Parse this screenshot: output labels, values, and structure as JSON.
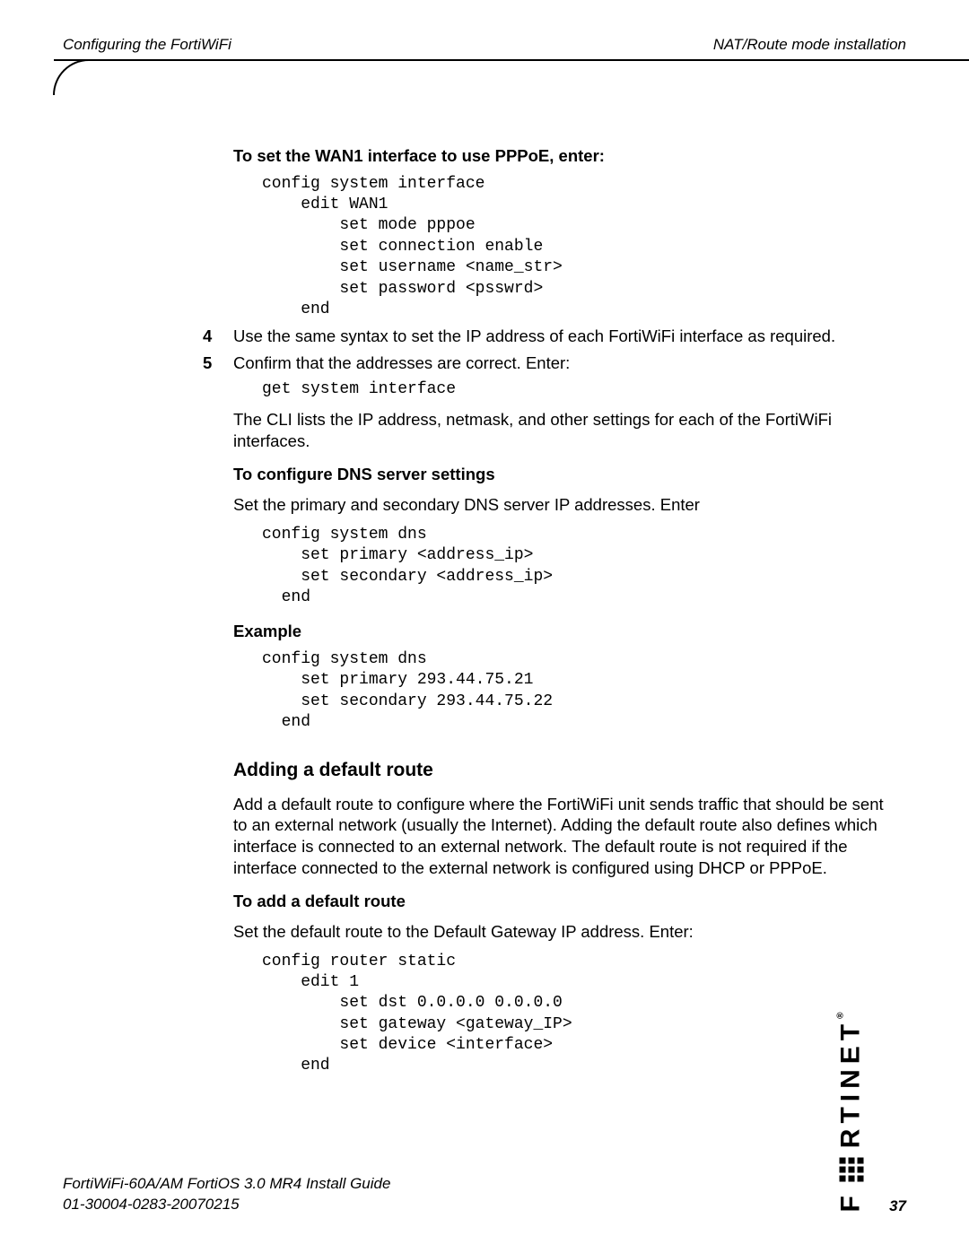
{
  "header": {
    "left": "Configuring the FortiWiFi",
    "right": "NAT/Route mode installation"
  },
  "sections": {
    "pppoe_heading": "To set the WAN1 interface to use PPPoE, enter:",
    "pppoe_code": "config system interface\n    edit WAN1\n        set mode pppoe\n        set connection enable\n        set username <name_str>\n        set password <psswrd>\n    end",
    "step4_num": "4",
    "step4_text": "Use the same syntax to set the IP address of each FortiWiFi interface as required.",
    "step5_num": "5",
    "step5_text": "Confirm that the addresses are correct. Enter:",
    "step5_code": "get system interface",
    "step5_after": "The CLI lists the IP address, netmask, and other settings for each of the FortiWiFi interfaces.",
    "dns_heading": "To configure DNS server settings",
    "dns_text": "Set the primary and secondary DNS server IP addresses. Enter",
    "dns_code": "config system dns\n    set primary <address_ip>\n    set secondary <address_ip>\n  end",
    "example_heading": "Example",
    "example_code": "config system dns\n    set primary 293.44.75.21\n    set secondary 293.44.75.22\n  end",
    "route_title": "Adding a default route",
    "route_intro": "Add a default route to configure where the FortiWiFi unit sends traffic that should be sent to an external network (usually the Internet). Adding the default route also defines which interface is connected to an external network. The default route is not required if the interface connected to the external network is configured using DHCP or PPPoE.",
    "route_sub": "To add a default route",
    "route_text": "Set the default route to the Default Gateway IP address. Enter:",
    "route_code": "config router static\n    edit 1\n        set dst 0.0.0.0 0.0.0.0\n        set gateway <gateway_IP>\n        set device <interface>\n    end"
  },
  "footer": {
    "line1": "FortiWiFi-60A/AM FortiOS 3.0 MR4 Install Guide",
    "line2": "01-30004-0283-20070215",
    "page": "37"
  },
  "brand": "F   RTINET"
}
